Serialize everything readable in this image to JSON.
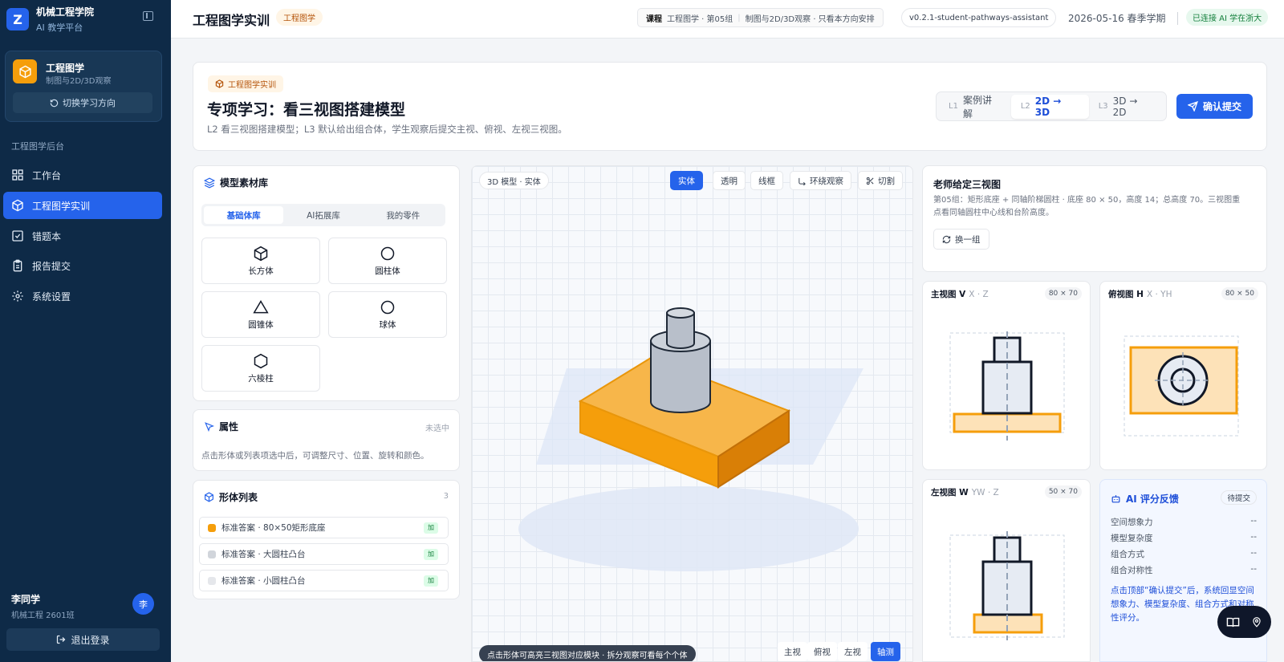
{
  "sidebar": {
    "logo_letter": "Z",
    "school": "机械工程学院",
    "platform": "AI 教学平台",
    "course": {
      "title": "工程图学",
      "subtitle": "制图与2D/3D观察",
      "switch_label": "切换学习方向"
    },
    "group_label": "工程图学后台",
    "items": [
      {
        "label": "工作台",
        "icon": "grid-icon",
        "active": false
      },
      {
        "label": "工程图学实训",
        "icon": "cube-icon",
        "active": true
      },
      {
        "label": "错题本",
        "icon": "check-square-icon",
        "active": false
      },
      {
        "label": "报告提交",
        "icon": "clipboard-icon",
        "active": false
      },
      {
        "label": "系统设置",
        "icon": "gear-icon",
        "active": false
      }
    ],
    "user": {
      "name": "李同学",
      "class": "机械工程 2601班",
      "avatar": "李"
    },
    "logout_label": "退出登录"
  },
  "topbar": {
    "title": "工程图学实训",
    "tag": "工程图学",
    "crumb_key": "课程",
    "crumb_course": "工程图学 · 第05组",
    "crumb_note": "制图与2D/3D观察 · 只看本方向安排",
    "version": "v0.2.1-student-pathways-assistant",
    "date": "2026-05-16 春季学期",
    "connection": "已连接 AI 学在浙大"
  },
  "hero": {
    "tag": "工程图学实训",
    "title": "专项学习：看三视图搭建模型",
    "desc": "L2 看三视图搭建模型；L3 默认给出组合体，学生观察后提交主视、俯视、左视三视图。",
    "levels": [
      {
        "code": "L1",
        "label": "案例讲解",
        "active": false
      },
      {
        "code": "L2",
        "label": "2D → 3D",
        "active": true
      },
      {
        "code": "L3",
        "label": "3D → 2D",
        "active": false
      }
    ],
    "submit_label": "确认提交"
  },
  "library": {
    "title": "模型素材库",
    "tabs": [
      "基础体库",
      "AI拓展库",
      "我的零件"
    ],
    "active_tab": 0,
    "shapes": [
      {
        "label": "长方体",
        "icon": "box-icon"
      },
      {
        "label": "圆柱体",
        "icon": "circle-icon"
      },
      {
        "label": "圆锥体",
        "icon": "triangle-icon"
      },
      {
        "label": "球体",
        "icon": "sphere-icon"
      },
      {
        "label": "六棱柱",
        "icon": "hexagon-icon"
      }
    ]
  },
  "properties": {
    "title": "属性",
    "status": "未选中",
    "hint": "点击形体或列表项选中后，可调整尺寸、位置、旋转和颜色。"
  },
  "body_list": {
    "title": "形体列表",
    "count": "3",
    "items": [
      {
        "label": "标准答案 · 80×50矩形底座",
        "color": "#f59e0b",
        "badge": "加"
      },
      {
        "label": "标准答案 · 大圆柱凸台",
        "color": "#d1d5db",
        "badge": "加"
      },
      {
        "label": "标准答案 · 小圆柱凸台",
        "color": "#e5e7eb",
        "badge": "加"
      }
    ]
  },
  "viewport": {
    "label": "3D 模型 · 实体",
    "modes": [
      "实体",
      "透明",
      "线框",
      "环绕观察",
      "切割"
    ],
    "active_mode": 0,
    "hint": "点击形体可高亮三视图对应模块 · 拆分观察可看每个个体",
    "views": [
      "主视",
      "俯视",
      "左视",
      "轴测"
    ],
    "active_view": 3
  },
  "given_views": {
    "title": "老师给定三视图",
    "desc": "第05组：矩形底座 + 同轴阶梯圆柱 · 底座 80 × 50，高度 14；总高度 70。三视图重点看同轴圆柱中心线和台阶高度。",
    "swap_label": "换一组",
    "front": {
      "name": "主视图 V",
      "axes": "X · Z",
      "dim": "80 × 70"
    },
    "top": {
      "name": "俯视图 H",
      "axes": "X · YH",
      "dim": "80 × 50"
    },
    "left": {
      "name": "左视图 W",
      "axes": "YW · Z",
      "dim": "50 × 70"
    }
  },
  "ai": {
    "title": "AI 评分反馈",
    "status": "待提交",
    "metrics": [
      {
        "label": "空间想象力",
        "value": "--"
      },
      {
        "label": "模型复杂度",
        "value": "--"
      },
      {
        "label": "组合方式",
        "value": "--"
      },
      {
        "label": "组合对称性",
        "value": "--"
      }
    ],
    "note": "点击顶部“确认提交”后，系统回显空间想象力、模型复杂度、组合方式和对称性评分。"
  },
  "colors": {
    "accent": "#2563eb",
    "sidebar": "#0e2a47",
    "base_orange": "#f59e0b",
    "cylinder": "#b8bfca"
  }
}
